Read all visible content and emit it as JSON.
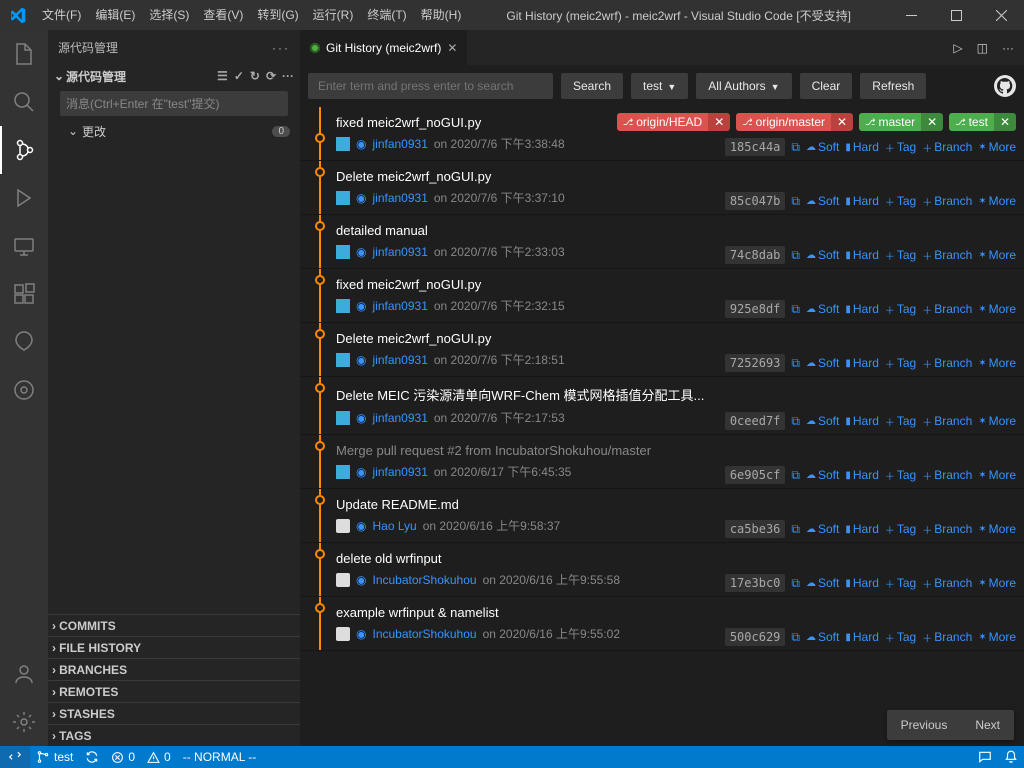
{
  "titlebar": {
    "menus": [
      "文件(F)",
      "编辑(E)",
      "选择(S)",
      "查看(V)",
      "转到(G)",
      "运行(R)",
      "终端(T)",
      "帮助(H)"
    ],
    "title": "Git History (meic2wrf) - meic2wrf - Visual Studio Code [不受支持]"
  },
  "sidebar": {
    "title": "源代码管理",
    "section": "源代码管理",
    "placeholder": "消息(Ctrl+Enter 在\"test\"提交)",
    "changes_label": "更改",
    "changes_count": "0",
    "bottom": [
      "COMMITS",
      "FILE HISTORY",
      "BRANCHES",
      "REMOTES",
      "STASHES",
      "TAGS"
    ]
  },
  "tab": {
    "title": "Git History (meic2wrf)"
  },
  "toolbar": {
    "search_placeholder": "Enter term and press enter to search",
    "search": "Search",
    "branch": "test",
    "authors": "All Authors",
    "clear": "Clear",
    "refresh": "Refresh"
  },
  "refs": {
    "origin_head": "origin/HEAD",
    "origin_master": "origin/master",
    "master": "master",
    "test": "test"
  },
  "actions": {
    "soft": "Soft",
    "hard": "Hard",
    "tag": "Tag",
    "branch": "Branch",
    "more": "More"
  },
  "commits": [
    {
      "subject": "fixed meic2wrf_noGUI.py",
      "author": "jinfan0931",
      "date": "on 2020/7/6 下午3:38:48",
      "hash": "185c44a",
      "avatar": "blue"
    },
    {
      "subject": "Delete meic2wrf_noGUI.py",
      "author": "jinfan0931",
      "date": "on 2020/7/6 下午3:37:10",
      "hash": "85c047b",
      "avatar": "blue"
    },
    {
      "subject": "detailed manual",
      "author": "jinfan0931",
      "date": "on 2020/7/6 下午2:33:03",
      "hash": "74c8dab",
      "avatar": "blue"
    },
    {
      "subject": "fixed meic2wrf_noGUI.py",
      "author": "jinfan0931",
      "date": "on 2020/7/6 下午2:32:15",
      "hash": "925e8df",
      "avatar": "blue"
    },
    {
      "subject": "Delete meic2wrf_noGUI.py",
      "author": "jinfan0931",
      "date": "on 2020/7/6 下午2:18:51",
      "hash": "7252693",
      "avatar": "blue"
    },
    {
      "subject": "Delete MEIC 污染源清单向WRF-Chem 模式网格插值分配工具...",
      "author": "jinfan0931",
      "date": "on 2020/7/6 下午2:17:53",
      "hash": "0ceed7f",
      "avatar": "blue"
    },
    {
      "subject": "Merge pull request #2 from IncubatorShokuhou/master",
      "author": "jinfan0931",
      "date": "on 2020/6/17 下午6:45:35",
      "hash": "6e905cf",
      "avatar": "blue",
      "merge": true
    },
    {
      "subject": "Update README.md",
      "author": "Hao Lyu",
      "date": "on 2020/6/16 上午9:58:37",
      "hash": "ca5be36",
      "avatar": "gh"
    },
    {
      "subject": "delete old wrfinput",
      "author": "IncubatorShokuhou",
      "date": "on 2020/6/16 上午9:55:58",
      "hash": "17e3bc0",
      "avatar": "gh"
    },
    {
      "subject": "example wrfinput & namelist",
      "author": "IncubatorShokuhou",
      "date": "on 2020/6/16 上午9:55:02",
      "hash": "500c629",
      "avatar": "gh"
    }
  ],
  "pager": {
    "prev": "Previous",
    "next": "Next"
  },
  "statusbar": {
    "branch": "test",
    "sync": "",
    "errors": "0",
    "warnings": "0",
    "mode": "-- NORMAL --"
  }
}
